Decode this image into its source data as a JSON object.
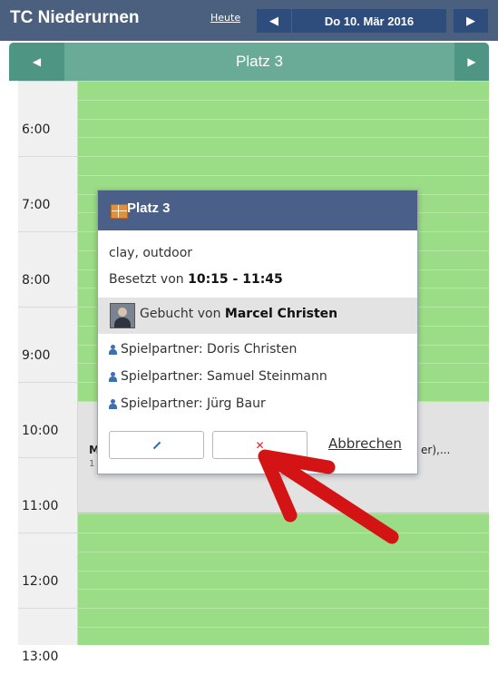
{
  "header": {
    "title": "TC Niederurnen",
    "today_label": "Heute",
    "prev_icon": "triangle-left-icon",
    "next_icon": "triangle-right-icon",
    "date": "Do 10. Mär 2016"
  },
  "court_header": {
    "name": "Platz 3",
    "prev_icon": "triangle-left-icon",
    "next_icon": "triangle-right-icon"
  },
  "timeline": {
    "times": [
      "6:00",
      "7:00",
      "8:00",
      "9:00",
      "10:00",
      "11:00",
      "12:00",
      "13:00"
    ]
  },
  "background_booking": {
    "fragment_name": "M",
    "fragment_sub": "1",
    "fragment_tail": "er),..."
  },
  "modal": {
    "title": "Platz 3",
    "court_type": "clay, outdoor",
    "occupied_prefix": "Besetzt von",
    "occupied_time": "10:15 - 11:45",
    "booked_by_prefix": "Gebucht von",
    "booked_by_name": "Marcel Christen",
    "partners": [
      {
        "label": "Spielpartner:",
        "name": "Doris Christen"
      },
      {
        "label": "Spielpartner:",
        "name": "Samuel Steinmann"
      },
      {
        "label": "Spielpartner:",
        "name": "Jürg Baur"
      }
    ],
    "cancel_label": "Abbrechen"
  },
  "colors": {
    "topbar": "#4b5f7e",
    "nav_button": "#2f4d7c",
    "court_header": "#6aab98",
    "free_slot": "#9bdc86",
    "booked_slot": "#e2e2e2",
    "modal_header": "#4b6089",
    "annotation_arrow": "#d41414"
  }
}
